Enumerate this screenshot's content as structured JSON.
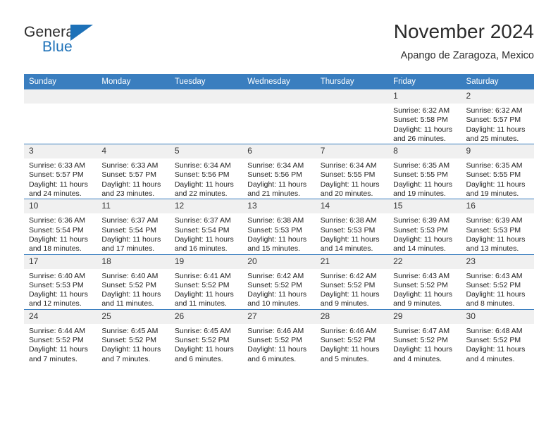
{
  "brand": {
    "name_part1": "General",
    "name_part2": "Blue",
    "logo_icon": "blue-triangle-logo",
    "accent_color": "#1d71b8"
  },
  "header": {
    "title": "November 2024",
    "subtitle": "Apango de Zaragoza, Mexico"
  },
  "calendar": {
    "header_color": "#3a7ebf",
    "daynum_band_color": "#f0f0f0",
    "weekday_headers": [
      "Sunday",
      "Monday",
      "Tuesday",
      "Wednesday",
      "Thursday",
      "Friday",
      "Saturday"
    ],
    "weeks": [
      [
        {
          "day": "",
          "lines": []
        },
        {
          "day": "",
          "lines": []
        },
        {
          "day": "",
          "lines": []
        },
        {
          "day": "",
          "lines": []
        },
        {
          "day": "",
          "lines": []
        },
        {
          "day": "1",
          "lines": [
            "Sunrise: 6:32 AM",
            "Sunset: 5:58 PM",
            "Daylight: 11 hours",
            "and 26 minutes."
          ]
        },
        {
          "day": "2",
          "lines": [
            "Sunrise: 6:32 AM",
            "Sunset: 5:57 PM",
            "Daylight: 11 hours",
            "and 25 minutes."
          ]
        }
      ],
      [
        {
          "day": "3",
          "lines": [
            "Sunrise: 6:33 AM",
            "Sunset: 5:57 PM",
            "Daylight: 11 hours",
            "and 24 minutes."
          ]
        },
        {
          "day": "4",
          "lines": [
            "Sunrise: 6:33 AM",
            "Sunset: 5:57 PM",
            "Daylight: 11 hours",
            "and 23 minutes."
          ]
        },
        {
          "day": "5",
          "lines": [
            "Sunrise: 6:34 AM",
            "Sunset: 5:56 PM",
            "Daylight: 11 hours",
            "and 22 minutes."
          ]
        },
        {
          "day": "6",
          "lines": [
            "Sunrise: 6:34 AM",
            "Sunset: 5:56 PM",
            "Daylight: 11 hours",
            "and 21 minutes."
          ]
        },
        {
          "day": "7",
          "lines": [
            "Sunrise: 6:34 AM",
            "Sunset: 5:55 PM",
            "Daylight: 11 hours",
            "and 20 minutes."
          ]
        },
        {
          "day": "8",
          "lines": [
            "Sunrise: 6:35 AM",
            "Sunset: 5:55 PM",
            "Daylight: 11 hours",
            "and 19 minutes."
          ]
        },
        {
          "day": "9",
          "lines": [
            "Sunrise: 6:35 AM",
            "Sunset: 5:55 PM",
            "Daylight: 11 hours",
            "and 19 minutes."
          ]
        }
      ],
      [
        {
          "day": "10",
          "lines": [
            "Sunrise: 6:36 AM",
            "Sunset: 5:54 PM",
            "Daylight: 11 hours",
            "and 18 minutes."
          ]
        },
        {
          "day": "11",
          "lines": [
            "Sunrise: 6:37 AM",
            "Sunset: 5:54 PM",
            "Daylight: 11 hours",
            "and 17 minutes."
          ]
        },
        {
          "day": "12",
          "lines": [
            "Sunrise: 6:37 AM",
            "Sunset: 5:54 PM",
            "Daylight: 11 hours",
            "and 16 minutes."
          ]
        },
        {
          "day": "13",
          "lines": [
            "Sunrise: 6:38 AM",
            "Sunset: 5:53 PM",
            "Daylight: 11 hours",
            "and 15 minutes."
          ]
        },
        {
          "day": "14",
          "lines": [
            "Sunrise: 6:38 AM",
            "Sunset: 5:53 PM",
            "Daylight: 11 hours",
            "and 14 minutes."
          ]
        },
        {
          "day": "15",
          "lines": [
            "Sunrise: 6:39 AM",
            "Sunset: 5:53 PM",
            "Daylight: 11 hours",
            "and 14 minutes."
          ]
        },
        {
          "day": "16",
          "lines": [
            "Sunrise: 6:39 AM",
            "Sunset: 5:53 PM",
            "Daylight: 11 hours",
            "and 13 minutes."
          ]
        }
      ],
      [
        {
          "day": "17",
          "lines": [
            "Sunrise: 6:40 AM",
            "Sunset: 5:53 PM",
            "Daylight: 11 hours",
            "and 12 minutes."
          ]
        },
        {
          "day": "18",
          "lines": [
            "Sunrise: 6:40 AM",
            "Sunset: 5:52 PM",
            "Daylight: 11 hours",
            "and 11 minutes."
          ]
        },
        {
          "day": "19",
          "lines": [
            "Sunrise: 6:41 AM",
            "Sunset: 5:52 PM",
            "Daylight: 11 hours",
            "and 11 minutes."
          ]
        },
        {
          "day": "20",
          "lines": [
            "Sunrise: 6:42 AM",
            "Sunset: 5:52 PM",
            "Daylight: 11 hours",
            "and 10 minutes."
          ]
        },
        {
          "day": "21",
          "lines": [
            "Sunrise: 6:42 AM",
            "Sunset: 5:52 PM",
            "Daylight: 11 hours",
            "and 9 minutes."
          ]
        },
        {
          "day": "22",
          "lines": [
            "Sunrise: 6:43 AM",
            "Sunset: 5:52 PM",
            "Daylight: 11 hours",
            "and 9 minutes."
          ]
        },
        {
          "day": "23",
          "lines": [
            "Sunrise: 6:43 AM",
            "Sunset: 5:52 PM",
            "Daylight: 11 hours",
            "and 8 minutes."
          ]
        }
      ],
      [
        {
          "day": "24",
          "lines": [
            "Sunrise: 6:44 AM",
            "Sunset: 5:52 PM",
            "Daylight: 11 hours",
            "and 7 minutes."
          ]
        },
        {
          "day": "25",
          "lines": [
            "Sunrise: 6:45 AM",
            "Sunset: 5:52 PM",
            "Daylight: 11 hours",
            "and 7 minutes."
          ]
        },
        {
          "day": "26",
          "lines": [
            "Sunrise: 6:45 AM",
            "Sunset: 5:52 PM",
            "Daylight: 11 hours",
            "and 6 minutes."
          ]
        },
        {
          "day": "27",
          "lines": [
            "Sunrise: 6:46 AM",
            "Sunset: 5:52 PM",
            "Daylight: 11 hours",
            "and 6 minutes."
          ]
        },
        {
          "day": "28",
          "lines": [
            "Sunrise: 6:46 AM",
            "Sunset: 5:52 PM",
            "Daylight: 11 hours",
            "and 5 minutes."
          ]
        },
        {
          "day": "29",
          "lines": [
            "Sunrise: 6:47 AM",
            "Sunset: 5:52 PM",
            "Daylight: 11 hours",
            "and 4 minutes."
          ]
        },
        {
          "day": "30",
          "lines": [
            "Sunrise: 6:48 AM",
            "Sunset: 5:52 PM",
            "Daylight: 11 hours",
            "and 4 minutes."
          ]
        }
      ]
    ]
  }
}
